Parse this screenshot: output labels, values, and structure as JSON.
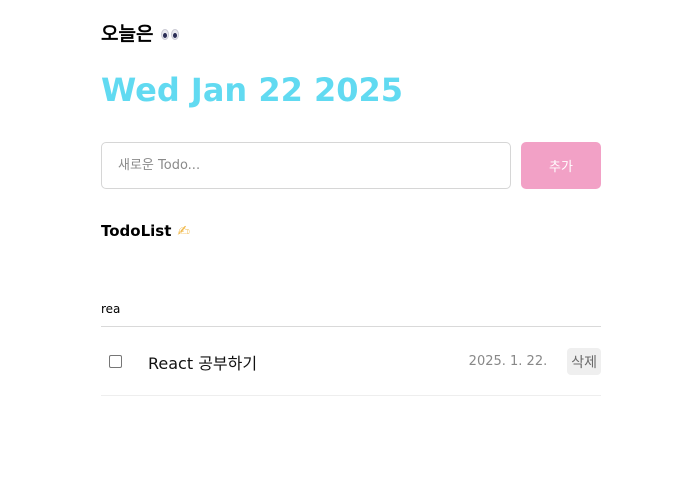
{
  "header": {
    "title": "오늘은",
    "icon": "eyes-icon",
    "date": "Wed Jan 22 2025",
    "date_color": "#61daf1"
  },
  "editor": {
    "placeholder": "새로운 Todo...",
    "value": "",
    "add_label": "추가",
    "add_color": "#f2a1c6"
  },
  "list": {
    "title": "TodoList",
    "title_icon": "writing-hand-icon",
    "search_value": "rea",
    "items": [
      {
        "checked": false,
        "content": "React 공부하기",
        "date": "2025. 1. 22.",
        "delete_label": "삭제"
      }
    ]
  }
}
